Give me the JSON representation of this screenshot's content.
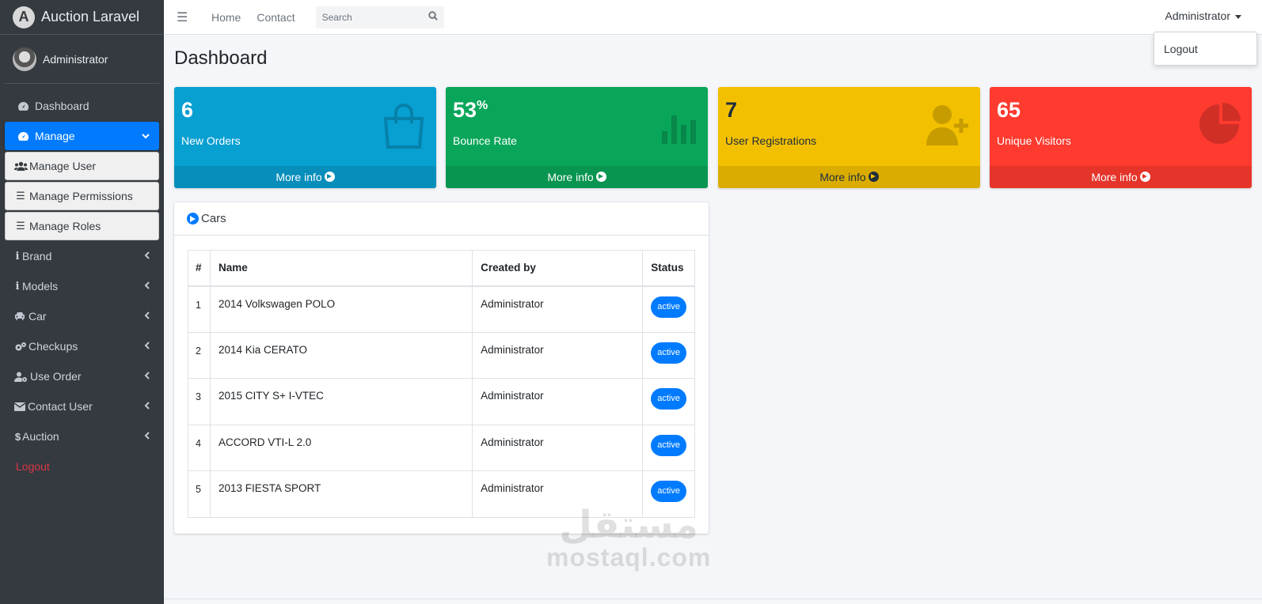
{
  "brand": {
    "name": "Auction Laravel",
    "logo_letter": "A"
  },
  "user": {
    "name": "Administrator"
  },
  "sidebar": {
    "items": [
      {
        "label": "Dashboard",
        "icon": "tachometer-icon"
      },
      {
        "label": "Manage",
        "icon": "tachometer-icon",
        "active": true
      },
      {
        "label": "Manage User",
        "icon": "users-icon",
        "sub": true
      },
      {
        "label": "Manage Permissions",
        "icon": "bars-icon",
        "sub": true
      },
      {
        "label": "Manage Roles",
        "icon": "bars-icon",
        "sub": true
      },
      {
        "label": "Brand",
        "icon": "info-icon"
      },
      {
        "label": "Models",
        "icon": "info-icon"
      },
      {
        "label": "Car",
        "icon": "car-icon"
      },
      {
        "label": "Checkups",
        "icon": "cogs-icon"
      },
      {
        "label": "Use Order",
        "icon": "user-cog-icon"
      },
      {
        "label": "Contact User",
        "icon": "envelope-icon"
      },
      {
        "label": "Auction",
        "icon": "dollar-icon"
      },
      {
        "label": "Logout",
        "icon": ""
      }
    ]
  },
  "topbar": {
    "links": [
      "Home",
      "Contact"
    ],
    "search_placeholder": "Search",
    "admin_label": "Administrator",
    "dropdown_item": "Logout"
  },
  "page": {
    "title": "Dashboard"
  },
  "stats": [
    {
      "value": "6",
      "suffix": "",
      "label": "New Orders",
      "more": "More info",
      "color": "#089fd1",
      "icon": "shopping-bag-icon"
    },
    {
      "value": "53",
      "suffix": "%",
      "label": "Bounce Rate",
      "more": "More info",
      "color": "#09a65a",
      "icon": "bar-chart-icon"
    },
    {
      "value": "7",
      "suffix": "",
      "label": "User Registrations",
      "more": "More info",
      "color": "#f3c000",
      "icon": "user-plus-icon"
    },
    {
      "value": "65",
      "suffix": "",
      "label": "Unique Visitors",
      "more": "More info",
      "color": "#ff3a2f",
      "icon": "pie-chart-icon"
    }
  ],
  "cars": {
    "title": "Cars",
    "columns": [
      "#",
      "Name",
      "Created by",
      "Status"
    ],
    "rows": [
      {
        "num": "1",
        "name": "2014 Volkswagen POLO",
        "created_by": "Administrator",
        "status": "active"
      },
      {
        "num": "2",
        "name": "2014 Kia CERATO",
        "created_by": "Administrator",
        "status": "active"
      },
      {
        "num": "3",
        "name": "2015 CITY S+ I-VTEC",
        "created_by": "Administrator",
        "status": "active"
      },
      {
        "num": "4",
        "name": "ACCORD VTI-L 2.0",
        "created_by": "Administrator",
        "status": "active"
      },
      {
        "num": "5",
        "name": "2013 FIESTA SPORT",
        "created_by": "Administrator",
        "status": "active"
      }
    ]
  },
  "watermark": {
    "arabic": "مستقل",
    "latin": "mostaql.com"
  },
  "colors": {
    "primary": "#007bff",
    "sidebar": "#343a40",
    "logout": "#dc3545"
  }
}
